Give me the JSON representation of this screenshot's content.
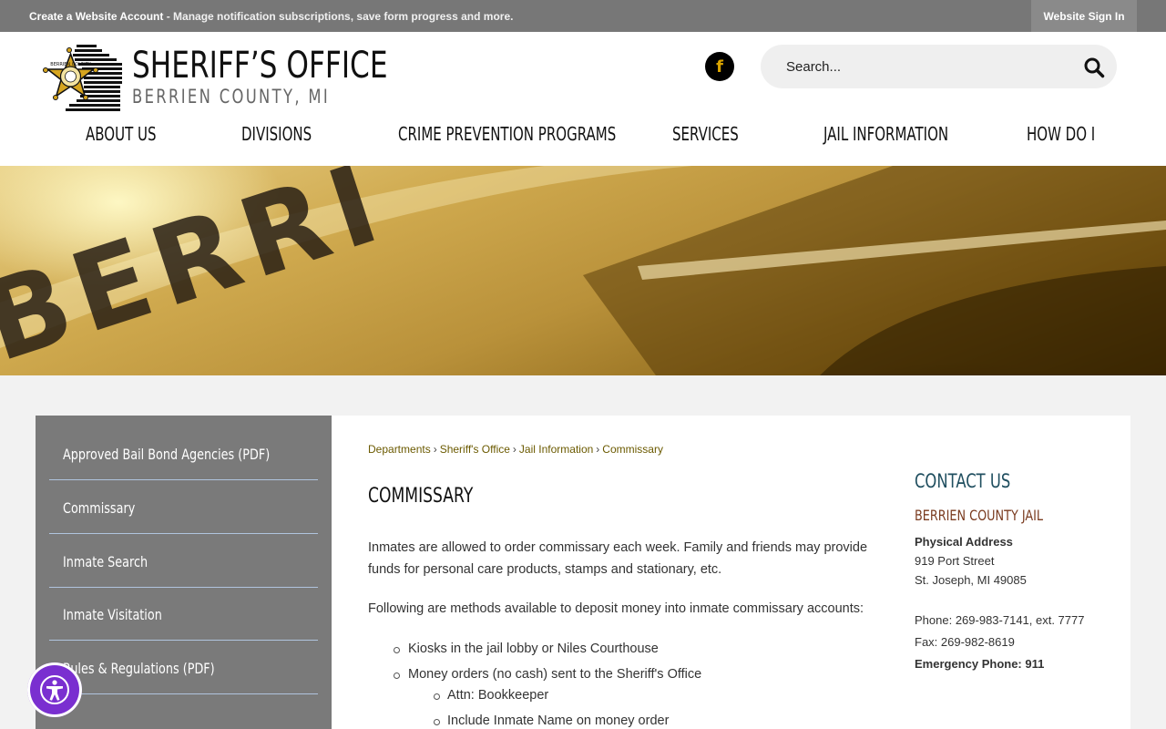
{
  "topbar": {
    "create_link": "Create a Website Account",
    "message": " - Manage notification subscriptions, save form progress and more.",
    "signin": "Website Sign In"
  },
  "header": {
    "logo_title": "SHERIFF’S OFFICE",
    "logo_subtitle": "BERRIEN COUNTY, MI",
    "badge_text": "BERRIEN COUNTY",
    "facebook_glyph": "f",
    "search_placeholder": "Search..."
  },
  "nav": [
    "ABOUT US",
    "DIVISIONS",
    "CRIME PREVENTION PROGRAMS",
    "SERVICES",
    "JAIL INFORMATION",
    "HOW DO I"
  ],
  "sidebar": [
    "Approved Bail Bond Agencies (PDF)",
    "Commissary",
    "Inmate Search",
    "Inmate Visitation",
    "Rules & Regulations (PDF)"
  ],
  "breadcrumb": [
    "Departments",
    "Sheriff's Office",
    "Jail Information",
    "Commissary"
  ],
  "main": {
    "title": "COMMISSARY",
    "para1": "Inmates are allowed to order commissary each week. Family and friends may provide funds for personal care products, stamps and stationary, etc.",
    "para2": "Following are methods available to deposit money into inmate commissary accounts:",
    "bullet1": "Kiosks in the jail lobby or Niles Courthouse",
    "bullet2": "Money orders (no cash) sent to the Sheriff's Office",
    "sub1": "Attn: Bookkeeper",
    "sub2": "Include Inmate Name on money order"
  },
  "contact": {
    "title": "CONTACT US",
    "org": "BERRIEN COUNTY JAIL",
    "address_label": "Physical Address",
    "street": "919 Port Street",
    "city": "St. Joseph, MI 49085",
    "phone": "Phone: 269-983-7141, ext. 7777",
    "fax": "Fax: 269-982-8619",
    "emergency": "Emergency Phone: 911"
  },
  "colors": {
    "topbar": "#777777",
    "sidebar": "#7a7a7a",
    "crumb_link": "#6b5a00",
    "contact_title": "#1f4e5f",
    "contact_org": "#7a3b1f",
    "accessibility": "#7a2fd0"
  },
  "hero_text": "BERRI"
}
